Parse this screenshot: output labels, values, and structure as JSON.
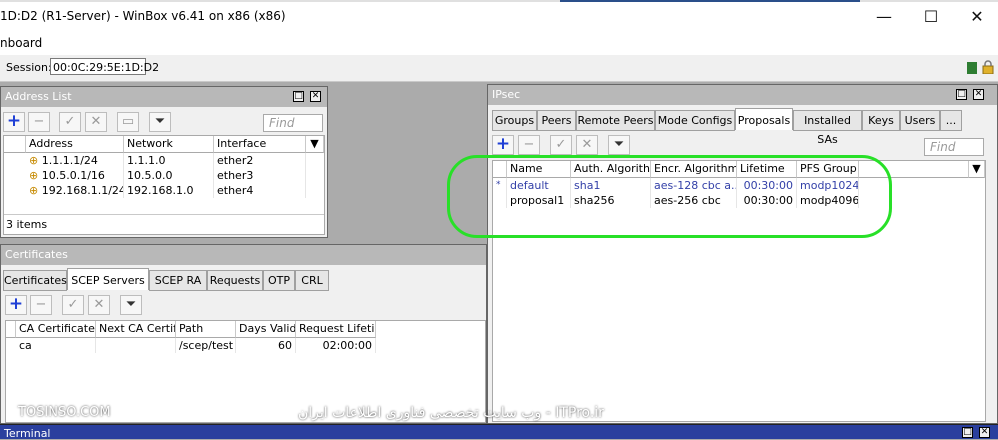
{
  "window": {
    "title": "1D:D2 (R1-Server) - WinBox v6.41 on x86 (x86)",
    "minimize": "—",
    "maximize": "☐",
    "close": "✕"
  },
  "menu": {
    "item": "nboard"
  },
  "session": {
    "label": "Session:",
    "value": "00:0C:29:5E:1D:D2"
  },
  "address_list": {
    "title": "Address List",
    "find_placeholder": "Find",
    "columns": [
      "Address",
      "Network",
      "Interface"
    ],
    "rows": [
      [
        "1.1.1.1/24",
        "1.1.1.0",
        "ether2"
      ],
      [
        "10.5.0.1/16",
        "10.5.0.0",
        "ether3"
      ],
      [
        "192.168.1.1/24",
        "192.168.1.0",
        "ether4"
      ]
    ],
    "status": "3 items"
  },
  "certificates": {
    "title": "Certificates",
    "tabs": [
      "Certificates",
      "SCEP Servers",
      "SCEP RA",
      "Requests",
      "OTP",
      "CRL"
    ],
    "active_tab": "SCEP Servers",
    "columns": [
      "CA Certificate",
      "Next CA Certif...",
      "Path",
      "Days Valid",
      "Request Lifeti..."
    ],
    "rows": [
      [
        "ca",
        "",
        "/scep/test",
        "60",
        "02:00:00"
      ]
    ]
  },
  "ipsec": {
    "title": "IPsec",
    "tabs": [
      "Groups",
      "Peers",
      "Remote Peers",
      "Mode Configs",
      "Proposals",
      "Installed SAs",
      "Keys",
      "Users",
      "..."
    ],
    "active_tab": "Proposals",
    "find_placeholder": "Find",
    "columns": [
      "Name",
      "Auth. Algorithms",
      "Encr. Algorithms",
      "Lifetime",
      "PFS Group"
    ],
    "rows": [
      {
        "flag": "*",
        "name": "default",
        "auth": "sha1",
        "encr": "aes-128 cbc a...",
        "lifetime": "00:30:00",
        "pfs": "modp1024",
        "is_default": true
      },
      {
        "flag": "",
        "name": "proposal1",
        "auth": "sha256",
        "encr": "aes-256 cbc",
        "lifetime": "00:30:00",
        "pfs": "modp4096",
        "is_default": false
      }
    ]
  },
  "watermark": {
    "left": "TOSINSO.COM",
    "center": "وب سایت تخصصی فناوری اطلاعات ایران - ITPro.ir"
  },
  "terminal": {
    "title": "Terminal"
  },
  "colors": {
    "highlight": "#28e028",
    "default_row_text": "#3340a8",
    "terminal_bar": "#2a3f9e"
  }
}
